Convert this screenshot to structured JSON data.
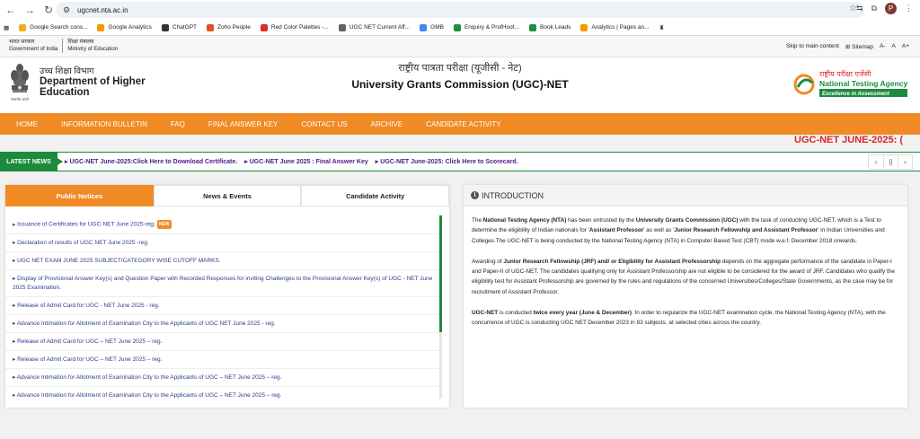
{
  "browser": {
    "url": "ugcnet.nta.ac.in",
    "profile_initial": "P",
    "bookmarks": [
      {
        "label": "Google Search cons...",
        "color": "#f2b01e"
      },
      {
        "label": "Google Analytics",
        "color": "#f29900"
      },
      {
        "label": "ChatGPT",
        "color": "#333333"
      },
      {
        "label": "Zoho People",
        "color": "#e44d26"
      },
      {
        "label": "Red Color Palettes -...",
        "color": "#d93025"
      },
      {
        "label": "UGC NET Current Aff...",
        "color": "#5f6368"
      },
      {
        "label": "GMB",
        "color": "#4285f4"
      },
      {
        "label": "Enquiry & ProfHoot...",
        "color": "#1e8e3e"
      },
      {
        "label": "Book Leads",
        "color": "#1e8e3e"
      },
      {
        "label": "Analytics | Pages an...",
        "color": "#f29900"
      }
    ]
  },
  "gov_strip": {
    "gov_hi": "भारत सरकार",
    "gov_en": "Government of India",
    "min_hi": "शिक्षा मंत्रालय",
    "min_en": "Ministry of Education",
    "skip": "Skip to main content",
    "sitemap": "Sitemap",
    "font_small": "A-",
    "font_normal": "A",
    "font_large": "A+"
  },
  "header": {
    "dept_hi": "उच्च शिक्षा विभाग",
    "dept_en_1": "Department of Higher",
    "dept_en_2": "Education",
    "emblem_motto": "सत्यमेव जयते",
    "title_hi": "राष्ट्रीय पात्रता परीक्षा (यूजीसी - नेट)",
    "title_en": "University Grants Commission (UGC)-NET",
    "nta_hi": "राष्ट्रीय परीक्षा एजेंसी",
    "nta_en": "National Testing Agency",
    "nta_tag": "Excellence in Assessment"
  },
  "nav": [
    "HOME",
    "INFORMATION BULLETIN",
    "FAQ",
    "FINAL ANSWER KEY",
    "CONTACT US",
    "ARCHIVE",
    "CANDIDATE ACTIVITY"
  ],
  "marquee_title": "UGC-NET JUNE-2025: (",
  "latest_news": {
    "label": "LATEST NEWS",
    "items": [
      "UGC-NET June-2025:Click Here to Download Certificate.",
      "UGC-NET June 2025 : Final Answer Key",
      "UGC-NET June-2025: Click Here to Scorecard."
    ]
  },
  "tabs": [
    "Public Notices",
    "News & Events",
    "Candidate Activity"
  ],
  "notices": [
    "Issuance of Certificates for UGC-NET June 2025-reg.",
    "Declaration of results of UGC NET June 2025 -reg.",
    "UGC NET EXAM JUNE 2025 SUBJECT/CATEGORY WISE CUTOFF MARKS.",
    "Display of Provisional Answer Key(s) and Question Paper with Recorded Responses for inviting Challenges to the Provisional Answer Key(s) of UGC - NET June 2025 Examination.",
    "Release of Admit Card for UGC - NET June 2025 - reg.",
    "Advance Intimation for Allotment of Examination City to the Applicants of UGC NET June 2025 - reg.",
    "Release of Admit Card for UGC – NET June 2025 – reg.",
    "Release of Admit Card for UGC – NET June 2025 – reg.",
    "Advance Intimation for Allotment of Examination City to the Applicants of UGC – NET June 2025 – reg.",
    "Advance Intimation for Allotment of Examination City to the Applicants of UGC – NET June 2025 – reg."
  ],
  "new_badge": "NEW",
  "intro": {
    "heading": "INTRODUCTION",
    "p1_a": "The ",
    "p1_b": "National Testing Agency (NTA)",
    "p1_c": " has been entrusted by the ",
    "p1_d": "University Grants Commission (UGC)",
    "p1_e": " with the task of conducting UGC-NET, which is a Test to determine the eligibility of Indian nationals for '",
    "p1_f": "Assistant Professor",
    "p1_g": "' as well as '",
    "p1_h": "Junior Research Fellowship and Assistant Professor",
    "p1_i": "' in Indian Universities and Colleges.The UGC-NET is being conducted by the National Testing Agency (NTA) in Computer Based Test (CBT) mode w.e.f. December 2018 onwards.",
    "p2_a": "Awarding of ",
    "p2_b": "Junior Research Fellowship (JRF) and/ or Eligibility for Assistant Professorship",
    "p2_c": " depends on the aggregate performance of the candidate in Paper-I and Paper-II of UGC-NET. The candidates qualifying only for Assistant Professorship are not eligible to be considered for the award of JRF. Candidates who qualify the eligibility test for Assistant Professorship are governed by the rules and regulations of the concerned Universities/Colleges/State Governments, as the case may be for recruitment of Assistant Professor.",
    "p3_a": "UGC-NET",
    "p3_b": " is conducted ",
    "p3_c": "twice every year (June & December)",
    "p3_d": ". In order to regularize the UGC-NET examination cycle, the National Testing Agency (NTA), with the concurrence of UGC is conducting UGC NET December 2023 in 83 subjects, at selected cities across the country."
  },
  "colors": {
    "accent_orange": "#f08a24",
    "news_green": "#1c8b3e",
    "link_blue": "#2a3d8f",
    "marquee_red": "#d92626"
  }
}
